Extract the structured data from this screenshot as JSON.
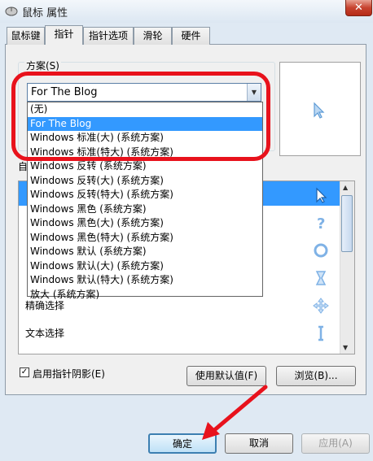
{
  "window": {
    "title": "鼠标 属性",
    "close_label": "✕"
  },
  "tabs": [
    "鼠标键",
    "指针",
    "指针选项",
    "滑轮",
    "硬件"
  ],
  "scheme": {
    "label": "方案(S)",
    "selected": "For The Blog",
    "options": [
      "(无)",
      "For The Blog",
      "Windows 标准(大) (系统方案)",
      "Windows 标准(特大) (系统方案)",
      "Windows 反转 (系统方案)",
      "Windows 反转(大) (系统方案)",
      "Windows 反转(特大) (系统方案)",
      "Windows 黑色 (系统方案)",
      "Windows 黑色(大) (系统方案)",
      "Windows 黑色(特大) (系统方案)",
      "Windows 默认 (系统方案)",
      "Windows 默认(大) (系统方案)",
      "Windows 默认(特大) (系统方案)",
      "放大 (系统方案)"
    ],
    "highlighted_option": "For The Blog"
  },
  "customize": {
    "label_visible_fragment": "自",
    "rows": [
      {
        "label": "",
        "icon": "arrow-cursor-icon"
      },
      {
        "label": "",
        "icon": "help-cursor-icon"
      },
      {
        "label": "",
        "icon": "busy-cursor-icon"
      },
      {
        "label": "",
        "icon": "working-cursor-icon"
      },
      {
        "label": "精确选择",
        "icon": "move-cursor-icon"
      },
      {
        "label": "文本选择",
        "icon": "text-cursor-icon"
      }
    ]
  },
  "shadow_checkbox": {
    "label": "启用指针阴影(E)",
    "checked": true
  },
  "buttons": {
    "use_default": "使用默认值(F)",
    "browse": "浏览(B)...",
    "ok": "确定",
    "cancel": "取消",
    "apply": "应用(A)"
  },
  "colors": {
    "selection": "#3399ff",
    "annotation_red": "#e8121c",
    "cursor_blue": "#7fb2e6"
  }
}
